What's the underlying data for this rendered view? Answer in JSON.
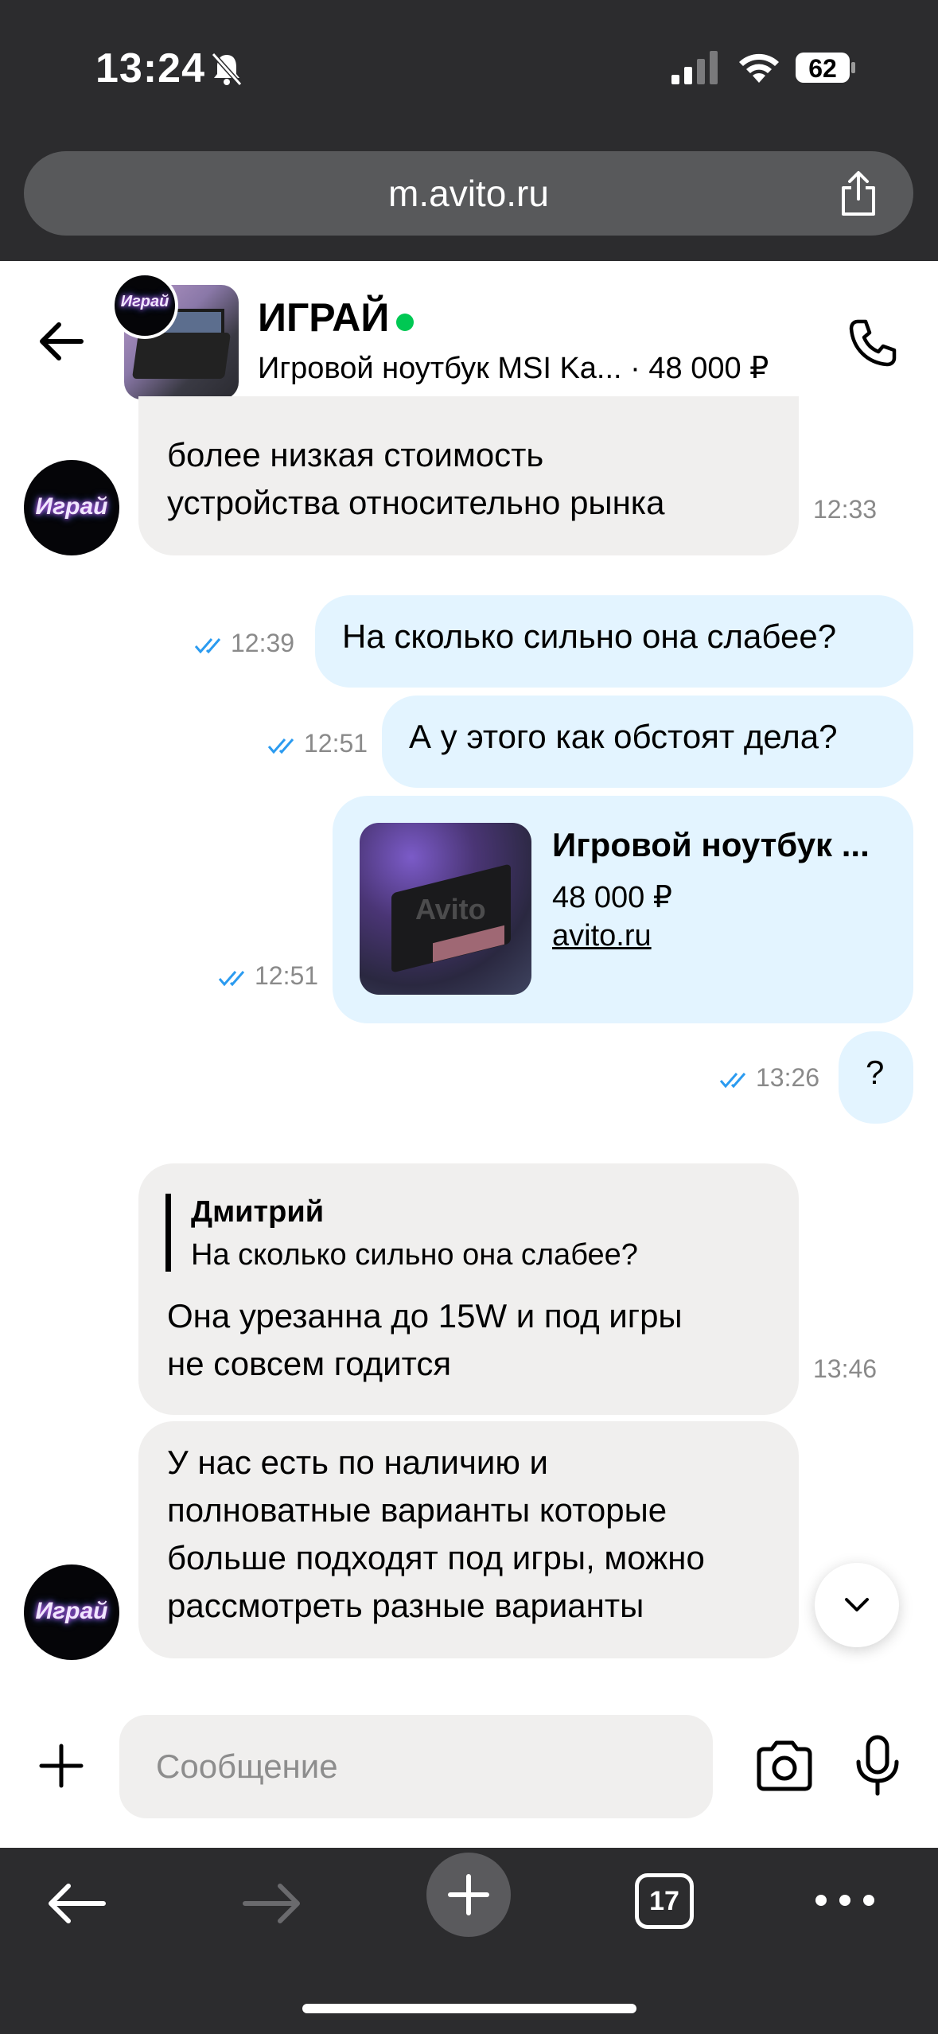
{
  "status_bar": {
    "time": "13:24",
    "battery": "62"
  },
  "browser": {
    "url": "m.avito.ru",
    "tab_count": "17"
  },
  "chat_header": {
    "shop_name": "ИГРАЙ",
    "product_title": "Игровой ноутбук MSI Ka... · 48 000 ₽",
    "logo_text": "Играй"
  },
  "messages": {
    "m1": {
      "line1": "более низкая стоимость",
      "line2": "устройства относительно рынка",
      "time": "12:33"
    },
    "m2": {
      "text": "На сколько сильно она слабее?",
      "time": "12:39"
    },
    "m3": {
      "text": "А у этого как обстоят дела?",
      "time": "12:51"
    },
    "m4": {
      "title": "Игровой ноутбук ...",
      "price": "48 000 ₽",
      "link": "avito.ru",
      "watermark": "Avito",
      "time": "12:51"
    },
    "m5": {
      "text": "?",
      "time": "13:26"
    },
    "m6": {
      "quote_author": "Дмитрий",
      "quote_text": "На сколько сильно она слабее?",
      "line1": "Она урезанна до 15W и под игры",
      "line2": "не совсем годится",
      "time": "13:46"
    },
    "m7": {
      "line1": "У нас есть по наличию и",
      "line2": "полноватные варианты которые",
      "line3": "больше подходят под игры, можно",
      "line4": "рассмотреть разные варианты"
    }
  },
  "composer": {
    "placeholder": "Сообщение"
  },
  "colors": {
    "online": "#00c853",
    "outgoing_bubble": "#e3f4ff",
    "incoming_bubble": "#f0efee",
    "ticks": "#2b9bf0"
  }
}
